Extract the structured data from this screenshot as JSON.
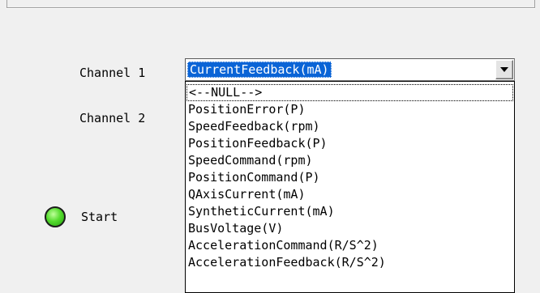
{
  "channel1": {
    "label": "Channel 1",
    "selected": "CurrentFeedback(mA)"
  },
  "channel2": {
    "label": "Channel 2"
  },
  "dropdown": {
    "options": [
      "<--NULL-->",
      "PositionError(P)",
      "SpeedFeedback(rpm)",
      "PositionFeedback(P)",
      "SpeedCommand(rpm)",
      "PositionCommand(P)",
      "QAxisCurrent(mA)",
      "SyntheticCurrent(mA)",
      "BusVoltage(V)",
      "AccelerationCommand(R/S^2)",
      "AccelerationFeedback(R/S^2)"
    ]
  },
  "start": {
    "label": "Start",
    "indicator_color": "#44cc22",
    "icon": "led-indicator-icon"
  }
}
